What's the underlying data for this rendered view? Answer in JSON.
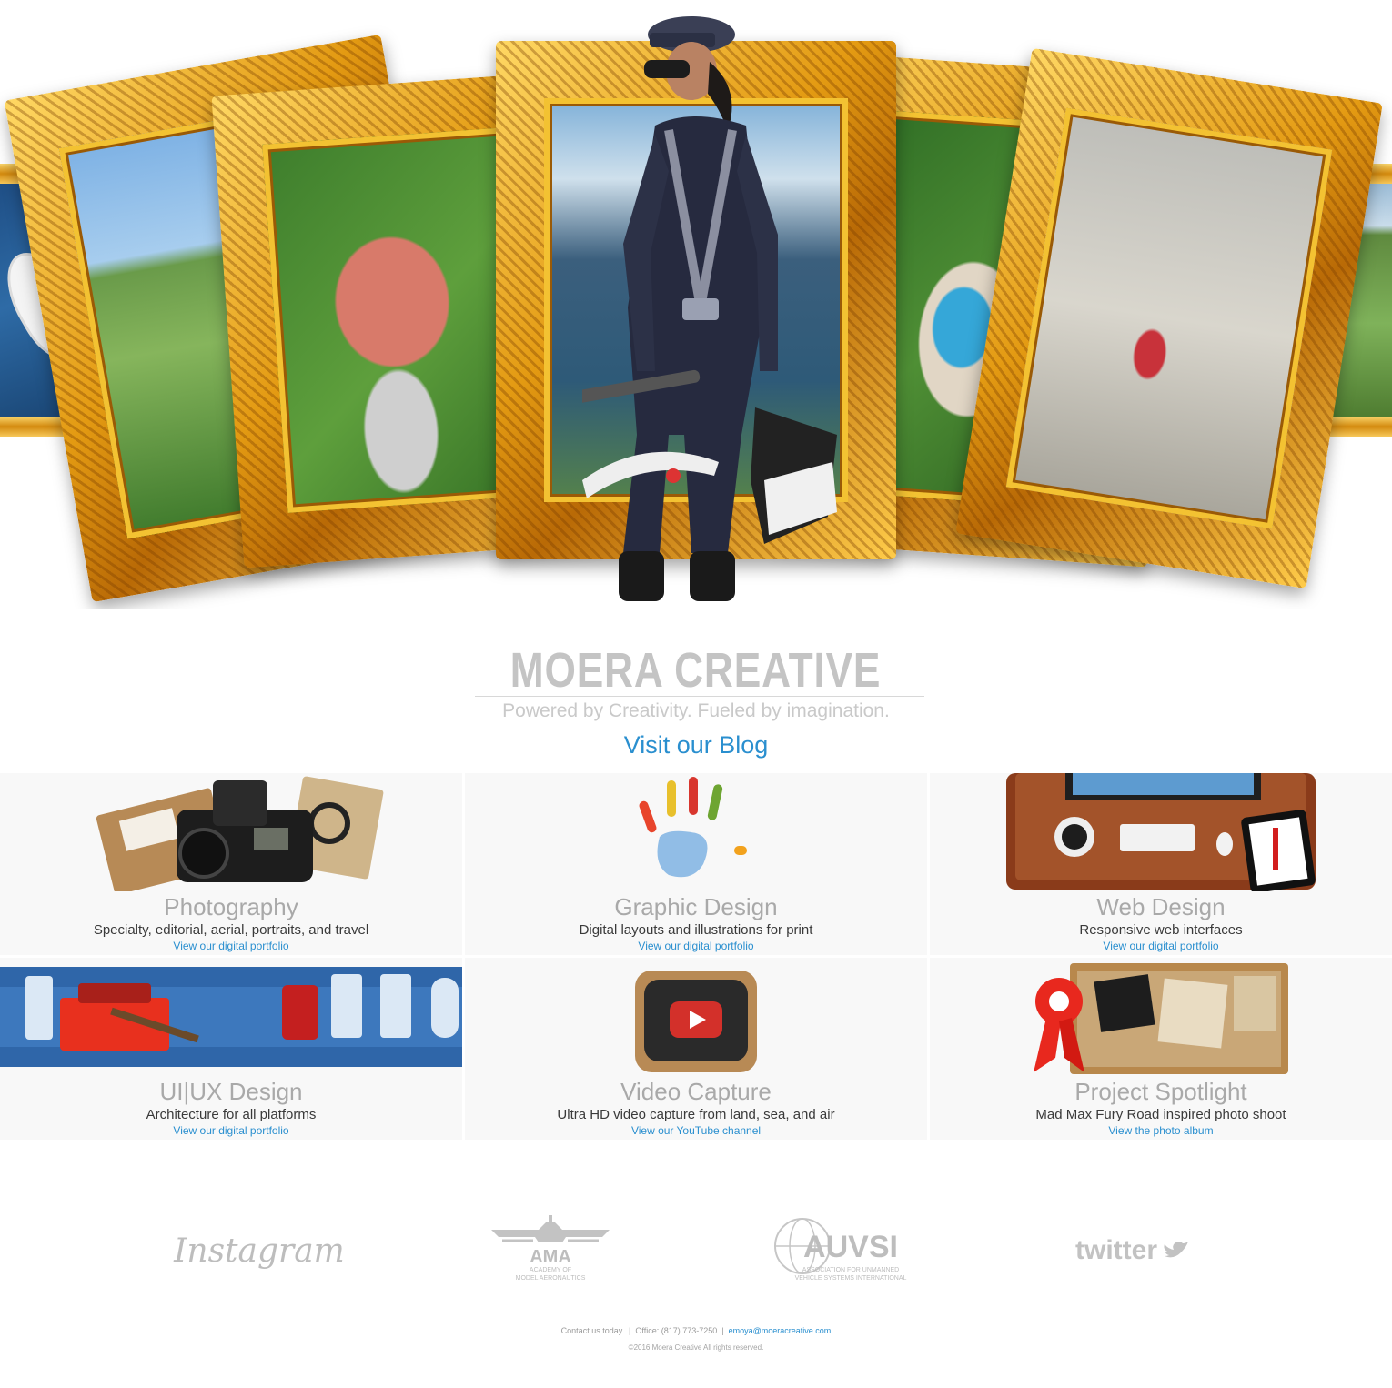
{
  "brand": {
    "title": "MOERA CREATIVE",
    "tagline": "Powered by Creativity. Fueled by imagination.",
    "blog_link": "Visit our Blog"
  },
  "carousel": {
    "slides": 4,
    "active": 0
  },
  "services": [
    {
      "title": "Photography",
      "desc": "Specialty, editorial, aerial, portraits, and travel",
      "link": "View our digital portfolio",
      "icon": "camera-kit-icon"
    },
    {
      "title": "Graphic Design",
      "desc": "Digital layouts and illustrations for print",
      "link": "View our digital portfolio",
      "icon": "painted-hand-icon"
    },
    {
      "title": "Web Design",
      "desc": "Responsive web interfaces",
      "link": "View our digital portfolio",
      "icon": "desk-computer-icon"
    },
    {
      "title": "UI|UX Design",
      "desc": "Architecture for all platforms",
      "link": "View our digital portfolio",
      "icon": "toolbox-icon"
    },
    {
      "title": "Video Capture",
      "desc": "Ultra HD video capture from land, sea, and air",
      "link": "View our YouTube channel",
      "icon": "retro-tv-play-icon"
    },
    {
      "title": "Project Spotlight",
      "desc": "Mad Max Fury Road inspired photo shoot",
      "link": "View the photo album",
      "icon": "ribbon-corkboard-icon"
    }
  ],
  "partners": {
    "instagram": "Instagram",
    "ama": "AMA",
    "ama_sub1": "ACADEMY OF",
    "ama_sub2": "MODEL AERONAUTICS",
    "auvsi": "AUVSI",
    "auvsi_sub1": "ASSOCIATION FOR UNMANNED",
    "auvsi_sub2": "VEHICLE SYSTEMS INTERNATIONAL",
    "twitter": "twitter"
  },
  "footer": {
    "contact": "Contact us today.",
    "office": "Office:  (817) 773-7250",
    "email": "emoya@moeracreative.com",
    "copyright": "©2016 Moera Creative All rights reserved."
  },
  "colors": {
    "accent": "#2a8fcf",
    "brand_gray": "#c4c4c4",
    "frame_gold": "#e39a12"
  }
}
